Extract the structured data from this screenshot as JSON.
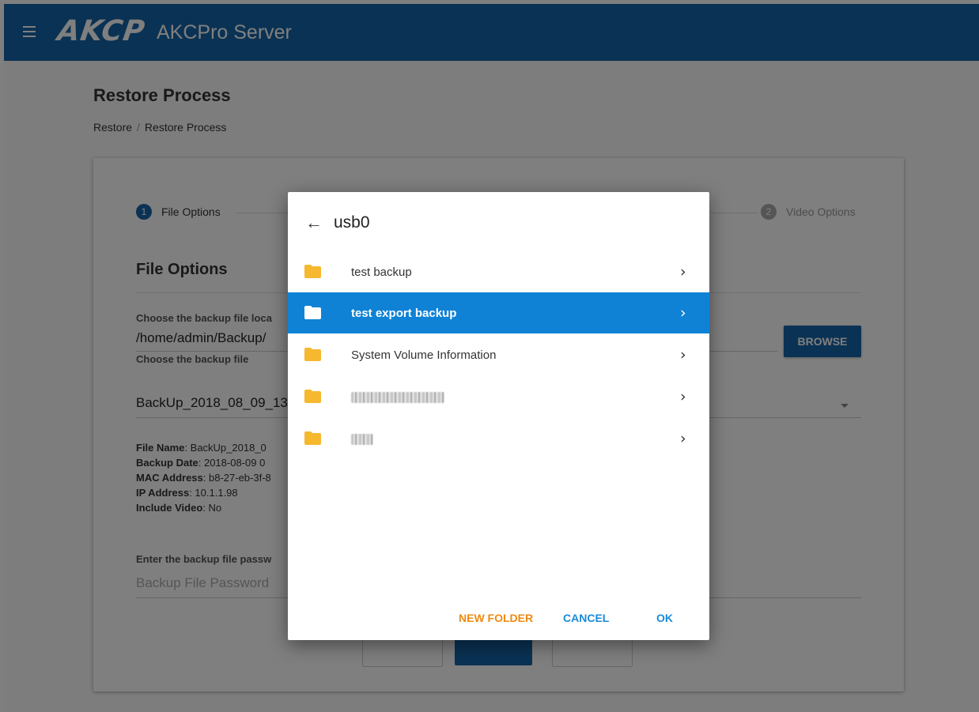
{
  "header": {
    "logo_text": "AKCP",
    "app_title": "AKCPro Server",
    "bg_color": "#1565a8"
  },
  "page": {
    "title": "Restore Process",
    "breadcrumb": {
      "root": "Restore",
      "sep": "/",
      "current": "Restore Process"
    }
  },
  "stepper": [
    {
      "number": "1",
      "label": "File Options",
      "active": true
    },
    {
      "number": "2",
      "label": "Video Options",
      "active": false
    }
  ],
  "form": {
    "section_title": "File Options",
    "location_label": "Choose the backup file loca",
    "location_value": "/home/admin/Backup/",
    "browse_label": "BROWSE",
    "file_label": "Choose the backup file",
    "file_value": "BackUp_2018_08_09_13",
    "info": [
      {
        "key": "File Name",
        "value": ": BackUp_2018_0"
      },
      {
        "key": "Backup Date",
        "value": ": 2018-08-09 0"
      },
      {
        "key": "MAC Address",
        "value": ": b8-27-eb-3f-8"
      },
      {
        "key": "IP Address",
        "value": ": 10.1.1.98"
      },
      {
        "key": "Include Video",
        "value": ": No"
      }
    ],
    "password_label": "Enter the backup file passw",
    "password_placeholder": "Backup File Password"
  },
  "dialog": {
    "back_icon": "arrow-left-icon",
    "title": "usb0",
    "folders": [
      {
        "name": "test backup",
        "selected": false
      },
      {
        "name": "test export backup",
        "selected": true
      },
      {
        "name": "System Volume Information",
        "selected": false
      }
    ],
    "buttons": {
      "new_folder": "NEW FOLDER",
      "cancel": "CANCEL",
      "ok": "OK"
    },
    "colors": {
      "selected_row": "#0f82d6",
      "new_folder": "#f08a10",
      "action": "#1a8ad8",
      "folder_icon": "#f5b82e"
    }
  }
}
